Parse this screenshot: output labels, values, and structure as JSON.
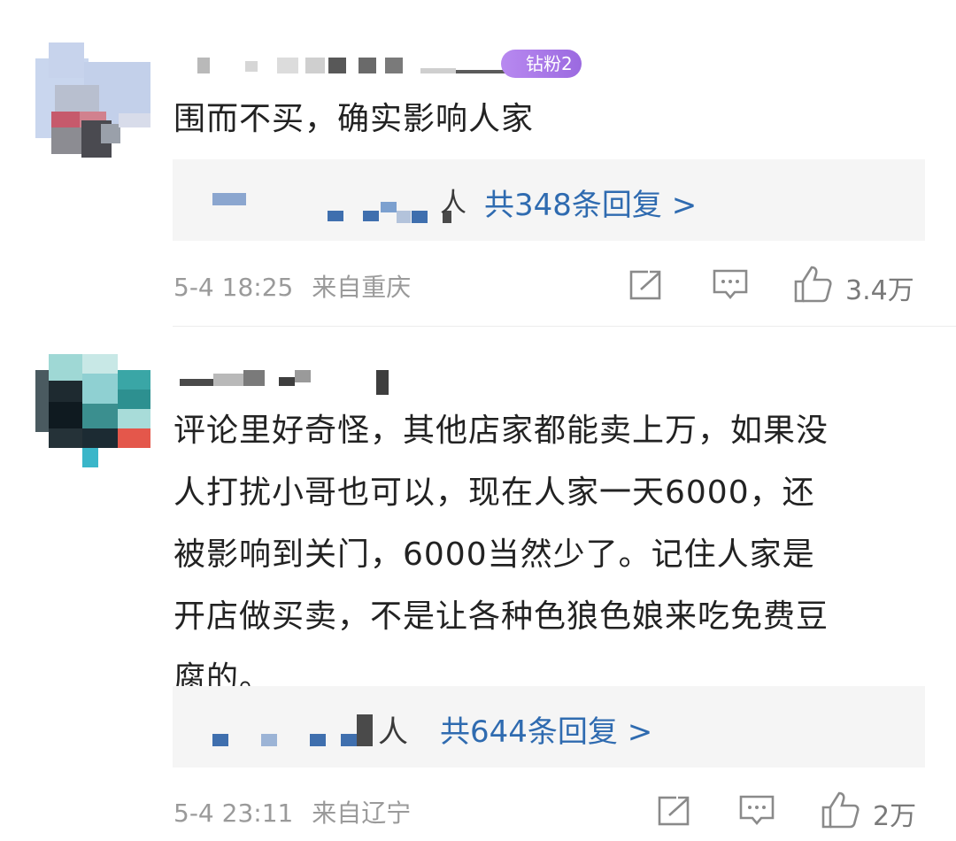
{
  "comments": [
    {
      "badge": "钻粉2",
      "text": "围而不买，确实影响人家",
      "reply_suffix": "人",
      "reply_link": "共348条回复 >",
      "timestamp": "5-4 18:25",
      "location": "来自重庆",
      "like_count": "3.4万"
    },
    {
      "text_lines": [
        "评论里好奇怪，其他店家都能卖上万，如果没",
        "人打扰小哥也可以，现在人家一天6000，还",
        "被影响到关门，6000当然少了。记住人家是",
        "开店做买卖，不是让各种色狼色娘来吃免费豆",
        "腐的。"
      ],
      "reply_suffix": "人",
      "reply_link": "共644条回复 >",
      "timestamp": "5-4 23:11",
      "location": "来自辽宁",
      "like_count": "2万"
    }
  ],
  "icons": {
    "share": "share-icon",
    "comment": "comment-icon",
    "like": "thumbs-up-icon"
  },
  "colors": {
    "link": "#2f6bb0",
    "meta": "#9a9a9a",
    "text": "#222222",
    "reply_bg": "#f5f5f5",
    "badge": "#a77ae6"
  }
}
